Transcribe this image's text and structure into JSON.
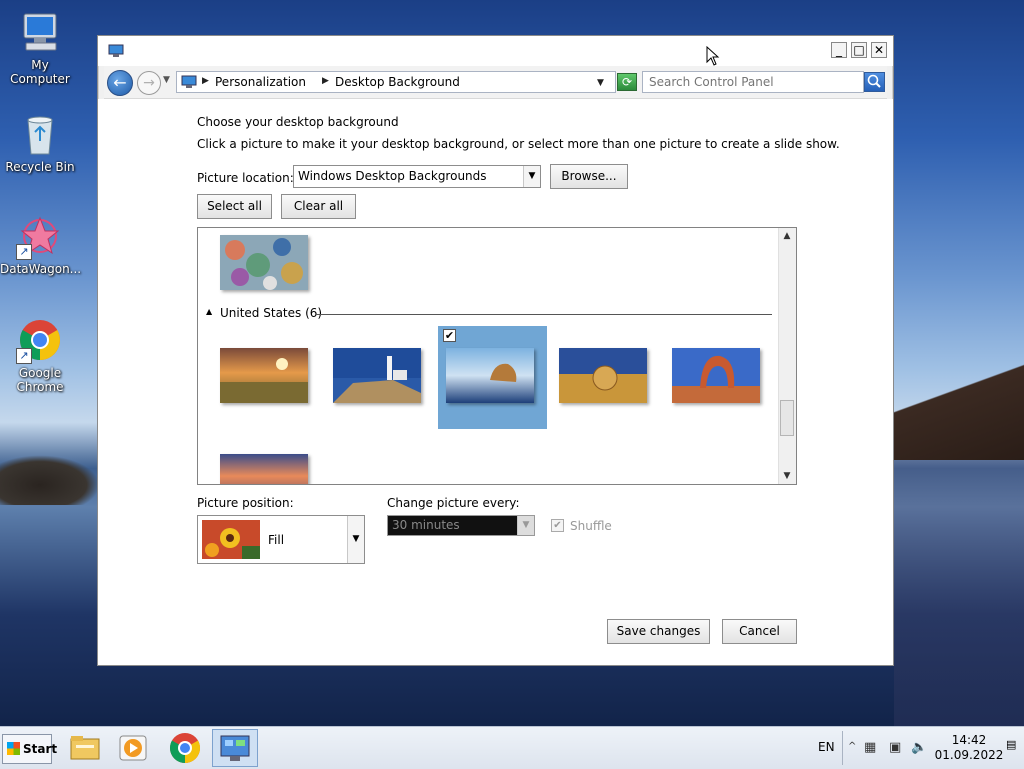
{
  "desktop": {
    "icons": [
      {
        "label": "My Computer",
        "icon": "computer-icon"
      },
      {
        "label": "Recycle Bin",
        "icon": "recycle-bin-icon"
      },
      {
        "label": "DataWagon...",
        "icon": "datawagon-icon"
      },
      {
        "label": "Google Chrome",
        "icon": "chrome-icon"
      }
    ]
  },
  "window": {
    "breadcrumb": [
      "Personalization",
      "Desktop Background"
    ],
    "search_placeholder": "Search Control Panel",
    "heading": "Choose your desktop background",
    "description": "Click a picture to make it your desktop background, or select more than one picture to create a slide show.",
    "picture_location_label": "Picture location:",
    "picture_location_value": "Windows Desktop Backgrounds",
    "browse_label": "Browse...",
    "select_all_label": "Select all",
    "clear_all_label": "Clear all",
    "group_header": "United States (6)",
    "selected_thumbnail_index": 2,
    "picture_position_label": "Picture position:",
    "picture_position_value": "Fill",
    "change_every_label": "Change picture every:",
    "change_every_value": "30 minutes",
    "shuffle_label": "Shuffle",
    "save_label": "Save changes",
    "cancel_label": "Cancel"
  },
  "taskbar": {
    "start_label": "Start",
    "language": "EN",
    "time": "14:42",
    "date": "01.09.2022"
  }
}
